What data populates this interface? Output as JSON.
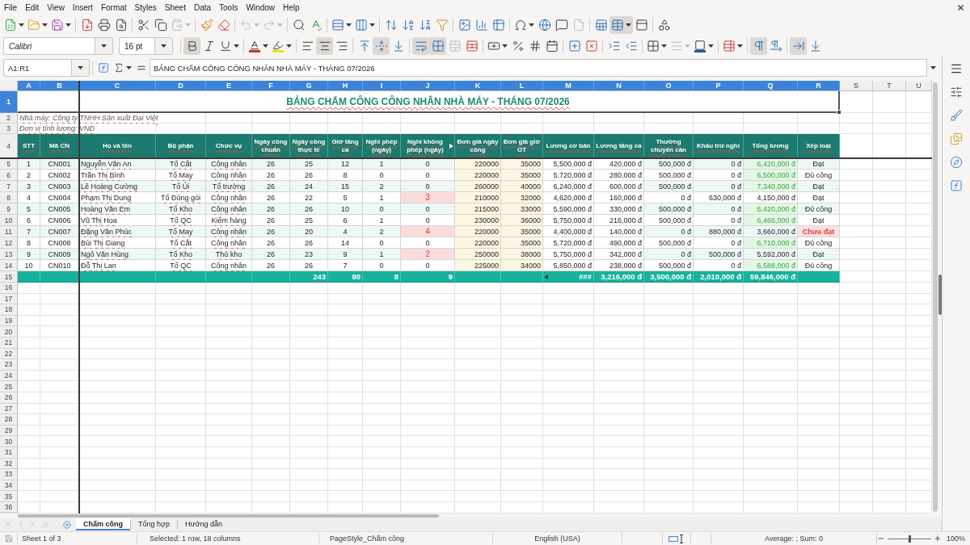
{
  "menu_bar": [
    "File",
    "Edit",
    "View",
    "Insert",
    "Format",
    "Styles",
    "Sheet",
    "Data",
    "Tools",
    "Window",
    "Help"
  ],
  "standard_toolbar": [
    [
      {
        "kind": "new",
        "on": false,
        "disabled": false
      },
      {
        "kind": "open",
        "on": false,
        "disabled": false
      },
      {
        "kind": "save",
        "on": false,
        "disabled": false
      }
    ],
    [
      {
        "kind": "export_pdf",
        "on": false,
        "disabled": false
      },
      {
        "kind": "print",
        "on": false,
        "disabled": false
      },
      {
        "kind": "print_preview",
        "on": false,
        "disabled": false
      }
    ],
    [
      {
        "kind": "cut",
        "on": false,
        "disabled": false
      },
      {
        "kind": "copy",
        "on": false,
        "disabled": false
      },
      {
        "kind": "paste",
        "on": false,
        "disabled": true
      }
    ],
    [
      {
        "kind": "clone_formatting",
        "on": false,
        "disabled": false
      },
      {
        "kind": "clear_formatting",
        "on": false,
        "disabled": false
      }
    ],
    [
      {
        "kind": "undo",
        "on": false,
        "disabled": true
      },
      {
        "kind": "redo",
        "on": false,
        "disabled": true
      }
    ],
    [
      {
        "kind": "find_replace",
        "on": false,
        "disabled": false
      },
      {
        "kind": "spelling",
        "on": false,
        "disabled": false
      }
    ],
    [
      {
        "kind": "rows",
        "on": false,
        "disabled": false
      },
      {
        "kind": "columns",
        "on": false,
        "disabled": false
      }
    ],
    [
      {
        "kind": "sort",
        "on": false,
        "disabled": false
      },
      {
        "kind": "sort_ascending",
        "on": false,
        "disabled": false
      },
      {
        "kind": "sort_descending",
        "on": false,
        "disabled": false
      },
      {
        "kind": "autofilter",
        "on": false,
        "disabled": false
      }
    ],
    [
      {
        "kind": "image",
        "on": false,
        "disabled": false
      },
      {
        "kind": "chart",
        "on": false,
        "disabled": false
      },
      {
        "kind": "pivot_table",
        "on": false,
        "disabled": false
      }
    ],
    [
      {
        "kind": "special_character",
        "on": false,
        "disabled": false
      },
      {
        "kind": "hyperlink",
        "on": false,
        "disabled": false
      },
      {
        "kind": "comment",
        "on": false,
        "disabled": false
      },
      {
        "kind": "headers_footers",
        "on": false,
        "disabled": true
      }
    ],
    [
      {
        "kind": "print_area",
        "on": false,
        "disabled": false
      },
      {
        "kind": "freeze",
        "on": true,
        "disabled": false
      },
      {
        "kind": "split_window",
        "on": false,
        "disabled": false
      }
    ],
    [
      {
        "kind": "draw_functions",
        "on": false,
        "disabled": false
      }
    ]
  ],
  "formatting_toolbar": {
    "font_name": "Calibri",
    "font_size": "16 pt",
    "groups": [
      [
        {
          "kind": "bold",
          "on": true,
          "disabled": false
        },
        {
          "kind": "italic",
          "on": false,
          "disabled": false
        },
        {
          "kind": "underline",
          "on": false,
          "disabled": false
        }
      ],
      [
        {
          "kind": "font_color",
          "on": false,
          "disabled": false
        },
        {
          "kind": "highlight",
          "on": false,
          "disabled": false
        }
      ],
      [
        {
          "kind": "align_left",
          "on": false,
          "disabled": false
        },
        {
          "kind": "align_center",
          "on": true,
          "disabled": false
        },
        {
          "kind": "align_right",
          "on": false,
          "disabled": false
        }
      ],
      [
        {
          "kind": "align_top",
          "on": false,
          "disabled": false
        },
        {
          "kind": "align_middle",
          "on": true,
          "disabled": false
        },
        {
          "kind": "align_bottom",
          "on": false,
          "disabled": false
        }
      ],
      [
        {
          "kind": "wrap_text",
          "on": true,
          "disabled": false
        },
        {
          "kind": "merge_center",
          "on": true,
          "disabled": false
        },
        {
          "kind": "merge_cells",
          "on": false,
          "disabled": true
        },
        {
          "kind": "unmerge_cells",
          "on": false,
          "disabled": false
        }
      ],
      [
        {
          "kind": "currency",
          "on": false,
          "disabled": false
        },
        {
          "kind": "percent",
          "on": false,
          "disabled": false
        },
        {
          "kind": "number",
          "on": false,
          "disabled": false
        },
        {
          "kind": "date",
          "on": false,
          "disabled": false
        }
      ],
      [
        {
          "kind": "add_decimal",
          "on": false,
          "disabled": false
        },
        {
          "kind": "delete_decimal",
          "on": false,
          "disabled": false
        }
      ],
      [
        {
          "kind": "indent_increase",
          "on": false,
          "disabled": false
        },
        {
          "kind": "indent_decrease",
          "on": false,
          "disabled": false
        }
      ],
      [
        {
          "kind": "borders",
          "on": false,
          "disabled": false
        },
        {
          "kind": "border_style",
          "on": false,
          "disabled": true
        },
        {
          "kind": "border_color",
          "on": false,
          "disabled": false
        }
      ],
      [
        {
          "kind": "conditional",
          "on": false,
          "disabled": false
        }
      ],
      [
        {
          "kind": "left_to_right",
          "on": true,
          "disabled": false
        },
        {
          "kind": "right_to_left",
          "on": false,
          "disabled": false
        }
      ],
      [
        {
          "kind": "text_horizontal",
          "on": true,
          "disabled": false
        },
        {
          "kind": "text_vertical",
          "on": false,
          "disabled": false
        }
      ]
    ]
  },
  "formula_bar": {
    "name_box": "A1:R1",
    "formula": "BẢNG CHẤM CÔNG CÔNG NHÂN NHÀ MÁY - THÁNG 07/2026"
  },
  "sheet": {
    "column_headers": [
      {
        "label": "A",
        "selected": true
      },
      {
        "label": "B",
        "selected": true
      },
      {
        "label": "C",
        "selected": true
      },
      {
        "label": "D",
        "selected": true
      },
      {
        "label": "E",
        "selected": true
      },
      {
        "label": "F",
        "selected": true
      },
      {
        "label": "G",
        "selected": true
      },
      {
        "label": "H",
        "selected": true
      },
      {
        "label": "I",
        "selected": true
      },
      {
        "label": "J",
        "selected": true
      },
      {
        "label": "K",
        "selected": true
      },
      {
        "label": "L",
        "selected": true
      },
      {
        "label": "M",
        "selected": true
      },
      {
        "label": "N",
        "selected": true
      },
      {
        "label": "O",
        "selected": true
      },
      {
        "label": "P",
        "selected": true
      },
      {
        "label": "Q",
        "selected": true
      },
      {
        "label": "R",
        "selected": true
      },
      {
        "label": "S",
        "selected": false
      },
      {
        "label": "T",
        "selected": false
      },
      {
        "label": "U",
        "selected": false
      }
    ],
    "row_headers": [
      {
        "label": "1",
        "selected": true
      },
      {
        "label": "2",
        "selected": false
      },
      {
        "label": "3",
        "selected": false
      },
      {
        "label": "4",
        "selected": false
      },
      {
        "label": "5",
        "selected": false
      },
      {
        "label": "6",
        "selected": false
      },
      {
        "label": "7",
        "selected": false
      },
      {
        "label": "8",
        "selected": false
      },
      {
        "label": "9",
        "selected": false
      },
      {
        "label": "10",
        "selected": false
      },
      {
        "label": "11",
        "selected": false
      },
      {
        "label": "12",
        "selected": false
      },
      {
        "label": "13",
        "selected": false
      },
      {
        "label": "14",
        "selected": false
      },
      {
        "label": "15",
        "selected": false
      },
      {
        "label": "16",
        "selected": false
      },
      {
        "label": "17",
        "selected": false
      },
      {
        "label": "18",
        "selected": false
      },
      {
        "label": "19",
        "selected": false
      },
      {
        "label": "20",
        "selected": false
      },
      {
        "label": "21",
        "selected": false
      },
      {
        "label": "22",
        "selected": false
      },
      {
        "label": "23",
        "selected": false
      },
      {
        "label": "24",
        "selected": false
      },
      {
        "label": "25",
        "selected": false
      },
      {
        "label": "26",
        "selected": false
      },
      {
        "label": "27",
        "selected": false
      },
      {
        "label": "28",
        "selected": false
      },
      {
        "label": "29",
        "selected": false
      },
      {
        "label": "30",
        "selected": false
      },
      {
        "label": "31",
        "selected": false
      },
      {
        "label": "32",
        "selected": false
      },
      {
        "label": "33",
        "selected": false
      },
      {
        "label": "34",
        "selected": false
      },
      {
        "label": "35",
        "selected": false
      },
      {
        "label": "36",
        "selected": false
      }
    ],
    "title": "BẢNG CHẤM CÔNG CÔNG NHÂN NHÀ MÁY - THÁNG 07/2026",
    "notes": [
      "Nhà máy: Công ty TNHH Sản xuất Đại Việt",
      "Đơn vị tính lương: VNĐ"
    ],
    "table": {
      "columns": [
        {
          "label": "STT",
          "clipped": false
        },
        {
          "label": "Mã CN",
          "clipped": false
        },
        {
          "label": "Họ và tên",
          "clipped": false
        },
        {
          "label": "Bộ phận",
          "clipped": false
        },
        {
          "label": "Chức vụ",
          "clipped": false
        },
        {
          "label": "Ngày công chuẩn",
          "clipped": false
        },
        {
          "label": "Ngày công thực tế",
          "clipped": false
        },
        {
          "label": "Giờ tăng ca",
          "clipped": false
        },
        {
          "label": "Nghỉ phép (ngày)",
          "clipped": false
        },
        {
          "label": "Nghỉ không phép (ngày)",
          "clipped": true
        },
        {
          "label": "Đơn giá ngày công",
          "clipped": false
        },
        {
          "label": "Đơn giá giờ OT",
          "clipped": false
        },
        {
          "label": "Lương cơ bản",
          "clipped": false
        },
        {
          "label": "Lương tăng ca",
          "clipped": false
        },
        {
          "label": "Thưởng chuyên cần",
          "clipped": false
        },
        {
          "label": "Khấu trừ nghỉ",
          "clipped": false
        },
        {
          "label": "Tổng lương",
          "clipped": false
        },
        {
          "label": "Xếp loại",
          "clipped": false
        }
      ],
      "rows": [
        {
          "cells": [
            "1",
            "CN001",
            "Nguyễn Văn An",
            "Tổ Cắt",
            "Công nhân",
            "26",
            "25",
            "12",
            "1",
            "0",
            "220000",
            "35000",
            "5,500,000 đ",
            "420,000 đ",
            "500,000 đ",
            "0 đ",
            "6,420,000 đ",
            "Đạt"
          ],
          "unpaid_alert": false,
          "high_total": true,
          "rating_alert": false
        },
        {
          "cells": [
            "2",
            "CN002",
            "Trần Thị Bình",
            "Tổ May",
            "Công nhân",
            "26",
            "26",
            "8",
            "0",
            "0",
            "220000",
            "35000",
            "5,720,000 đ",
            "280,000 đ",
            "500,000 đ",
            "0 đ",
            "6,500,000 đ",
            "Đủ công"
          ],
          "unpaid_alert": false,
          "high_total": true,
          "rating_alert": false
        },
        {
          "cells": [
            "3",
            "CN003",
            "Lê Hoàng Cường",
            "Tổ Ủi",
            "Tổ trưởng",
            "26",
            "24",
            "15",
            "2",
            "0",
            "260000",
            "40000",
            "6,240,000 đ",
            "600,000 đ",
            "500,000 đ",
            "0 đ",
            "7,340,000 đ",
            "Đạt"
          ],
          "unpaid_alert": false,
          "high_total": true,
          "rating_alert": false
        },
        {
          "cells": [
            "4",
            "CN004",
            "Phạm Thị Dung",
            "Tổ Đóng gói",
            "Công nhân",
            "26",
            "22",
            "5",
            "1",
            "3",
            "210000",
            "32000",
            "4,620,000 đ",
            "160,000 đ",
            "0 đ",
            "630,000 đ",
            "4,150,000 đ",
            "Đạt"
          ],
          "unpaid_alert": true,
          "high_total": false,
          "rating_alert": false
        },
        {
          "cells": [
            "5",
            "CN005",
            "Hoàng Văn Em",
            "Tổ Kho",
            "Công nhân",
            "26",
            "26",
            "10",
            "0",
            "0",
            "215000",
            "33000",
            "5,590,000 đ",
            "330,000 đ",
            "500,000 đ",
            "0 đ",
            "6,420,000 đ",
            "Đủ công"
          ],
          "unpaid_alert": false,
          "high_total": true,
          "rating_alert": false
        },
        {
          "cells": [
            "6",
            "CN006",
            "Vũ Thị Hoa",
            "Tổ QC",
            "Kiểm hàng",
            "26",
            "25",
            "6",
            "1",
            "0",
            "230000",
            "36000",
            "5,750,000 đ",
            "216,000 đ",
            "500,000 đ",
            "0 đ",
            "6,466,000 đ",
            "Đạt"
          ],
          "unpaid_alert": false,
          "high_total": true,
          "rating_alert": false
        },
        {
          "cells": [
            "7",
            "CN007",
            "Đặng Văn Phúc",
            "Tổ May",
            "Công nhân",
            "26",
            "20",
            "4",
            "2",
            "4",
            "220000",
            "35000",
            "4,400,000 đ",
            "140,000 đ",
            "0 đ",
            "880,000 đ",
            "3,660,000 đ",
            "Chưa đạt"
          ],
          "unpaid_alert": true,
          "high_total": false,
          "rating_alert": true
        },
        {
          "cells": [
            "8",
            "CN008",
            "Bùi Thị Giang",
            "Tổ Cắt",
            "Công nhân",
            "26",
            "26",
            "14",
            "0",
            "0",
            "220000",
            "35000",
            "5,720,000 đ",
            "490,000 đ",
            "500,000 đ",
            "0 đ",
            "6,710,000 đ",
            "Đủ công"
          ],
          "unpaid_alert": false,
          "high_total": true,
          "rating_alert": false
        },
        {
          "cells": [
            "9",
            "CN009",
            "Ngô Văn Hùng",
            "Tổ Kho",
            "Thủ kho",
            "26",
            "23",
            "9",
            "1",
            "2",
            "250000",
            "38000",
            "5,750,000 đ",
            "342,000 đ",
            "0 đ",
            "500,000 đ",
            "5,592,000 đ",
            "Đạt"
          ],
          "unpaid_alert": true,
          "high_total": false,
          "rating_alert": false
        },
        {
          "cells": [
            "10",
            "CN010",
            "Đỗ Thị Lan",
            "Tổ QC",
            "Công nhân",
            "26",
            "26",
            "7",
            "0",
            "0",
            "225000",
            "34000",
            "5,850,000 đ",
            "238,000 đ",
            "500,000 đ",
            "0 đ",
            "6,588,000 đ",
            "Đủ công"
          ],
          "unpaid_alert": false,
          "high_total": true,
          "rating_alert": false
        }
      ],
      "totals": {
        "actual_days": {
          "text": "243",
          "clipped": false
        },
        "overtime_hours": {
          "text": "90",
          "clipped": false
        },
        "paid_leave": {
          "text": "8",
          "clipped": false
        },
        "unpaid_leave": {
          "text": "9",
          "clipped": false
        },
        "base_salary": {
          "text": "###",
          "clipped": true
        },
        "overtime_pay": {
          "text": "3,216,000 đ",
          "clipped": false
        },
        "attendance_bonus": {
          "text": "3,500,000 đ",
          "clipped": false
        },
        "deductions": {
          "text": "2,010,000 đ",
          "clipped": false
        },
        "total_salary": {
          "text": "59,846,000 đ",
          "clipped": false
        }
      }
    }
  },
  "sheet_tabs": {
    "navigation": {
      "disabled": true
    },
    "tabs": [
      {
        "label": "Chấm công",
        "selected": true
      },
      {
        "label": "Tổng hợp",
        "selected": false
      },
      {
        "label": "Hướng dẫn",
        "selected": false
      }
    ]
  },
  "status_bar": {
    "sheet": "Sheet 1 of 3",
    "selection": "Selected: 1 row, 18 columns",
    "page_style": "PageStyle_Chấm công",
    "language": "English (USA)",
    "summary": "Average: ; Sum: 0",
    "zoom_slider": {
      "level": 0.5
    },
    "zoom": "100%"
  }
}
